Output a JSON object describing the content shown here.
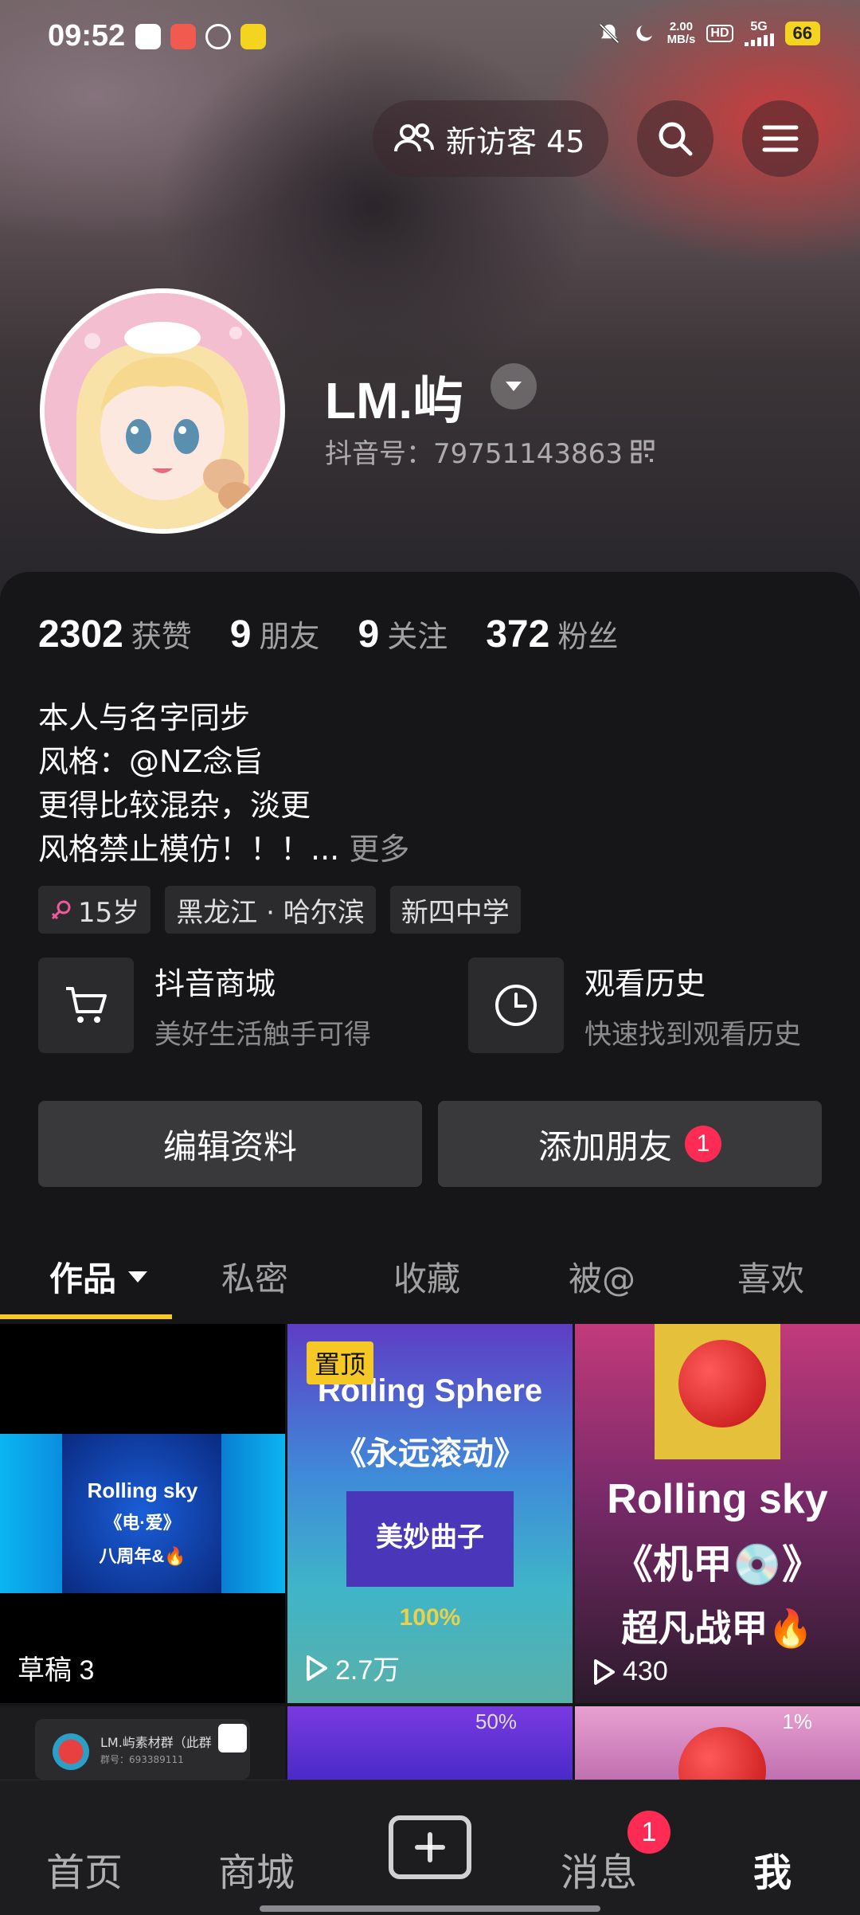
{
  "status": {
    "time": "09:52",
    "speed_value": "2.00",
    "speed_unit": "MB/s",
    "hd": "HD",
    "network": "5G",
    "battery": "66"
  },
  "header": {
    "visitor_label": "新访客 45"
  },
  "profile": {
    "name": "LM.屿",
    "douyin_id": "抖音号：79751143863"
  },
  "stats": [
    {
      "num": "2302",
      "label": "获赞"
    },
    {
      "num": "9",
      "label": "朋友"
    },
    {
      "num": "9",
      "label": "关注"
    },
    {
      "num": "372",
      "label": "粉丝"
    }
  ],
  "bio": {
    "line1": "本人与名字同步",
    "line2": "风格：@NZ念旨",
    "line3": "更得比较混杂，淡更",
    "line4": "风格禁止模仿！！！...",
    "more": "更多"
  },
  "tags": {
    "age": "15岁",
    "location": "黑龙江 · 哈尔滨",
    "school": "新四中学"
  },
  "shortcuts": {
    "mall_title": "抖音商城",
    "mall_sub": "美好生活触手可得",
    "history_title": "观看历史",
    "history_sub": "快速找到观看历史"
  },
  "actions": {
    "edit": "编辑资料",
    "add_friend": "添加朋友",
    "add_friend_badge": "1"
  },
  "tabs": {
    "works": "作品",
    "private": "私密",
    "favorites": "收藏",
    "mentioned": "被@",
    "likes": "喜欢"
  },
  "grid": {
    "draft_label": "草稿 3",
    "pinned": "置顶",
    "video2_views": "2.7万",
    "video3_views": "430",
    "art1_line1": "Rolling sky",
    "art1_line2": "《电·爱》",
    "art1_line3": "八周年&🔥",
    "art2_line1": "Rolling Sphere",
    "art2_line2": "《永远滚动》",
    "art2_line3": "美妙曲子",
    "art2_line4": "100%",
    "art3_line1": "Rolling sky",
    "art3_line2": "《机甲💿》",
    "art3_line3": "超凡战甲🔥",
    "row2_percent_a": "50%",
    "row2_percent_b": "1%",
    "group_name": "LM.屿素材群（此群",
    "group_id": "群号：693389111"
  },
  "bottom_nav": {
    "home": "首页",
    "mall": "商城",
    "messages": "消息",
    "messages_badge": "1",
    "me": "我"
  },
  "colors": {
    "accent_yellow": "#f5c826",
    "badge_red": "#fe2c55",
    "background": "#161618"
  }
}
